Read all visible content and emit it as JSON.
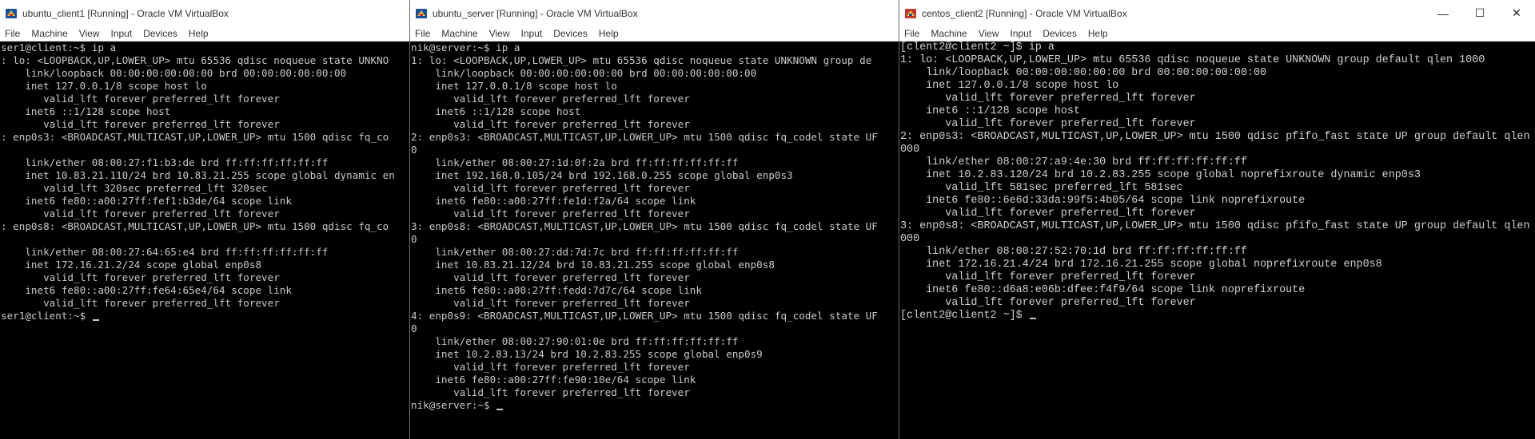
{
  "windows": [
    {
      "title": "ubuntu_client1 [Running] - Oracle VM VirtualBox",
      "menu": [
        "File",
        "Machine",
        "View",
        "Input",
        "Devices",
        "Help"
      ],
      "lines": [
        "ser1@client:~$ ip a",
        ": lo: <LOOPBACK,UP,LOWER_UP> mtu 65536 qdisc noqueue state UNKNO",
        "    link/loopback 00:00:00:00:00:00 brd 00:00:00:00:00:00",
        "    inet 127.0.0.1/8 scope host lo",
        "       valid_lft forever preferred_lft forever",
        "    inet6 ::1/128 scope host",
        "       valid_lft forever preferred_lft forever",
        ": enp0s3: <BROADCAST,MULTICAST,UP,LOWER_UP> mtu 1500 qdisc fq_co",
        "",
        "    link/ether 08:00:27:f1:b3:de brd ff:ff:ff:ff:ff:ff",
        "    inet 10.83.21.110/24 brd 10.83.21.255 scope global dynamic en",
        "       valid_lft 320sec preferred_lft 320sec",
        "    inet6 fe80::a00:27ff:fef1:b3de/64 scope link",
        "       valid_lft forever preferred_lft forever",
        ": enp0s8: <BROADCAST,MULTICAST,UP,LOWER_UP> mtu 1500 qdisc fq_co",
        "",
        "    link/ether 08:00:27:64:65:e4 brd ff:ff:ff:ff:ff:ff",
        "    inet 172.16.21.2/24 scope global enp0s8",
        "       valid_lft forever preferred_lft forever",
        "    inet6 fe80::a00:27ff:fe64:65e4/64 scope link",
        "       valid_lft forever preferred_lft forever",
        "ser1@client:~$ "
      ]
    },
    {
      "title": "ubuntu_server [Running] - Oracle VM VirtualBox",
      "menu": [
        "File",
        "Machine",
        "View",
        "Input",
        "Devices",
        "Help"
      ],
      "lines": [
        "nik@server:~$ ip a",
        "1: lo: <LOOPBACK,UP,LOWER_UP> mtu 65536 qdisc noqueue state UNKNOWN group de",
        "    link/loopback 00:00:00:00:00:00 brd 00:00:00:00:00:00",
        "    inet 127.0.0.1/8 scope host lo",
        "       valid_lft forever preferred_lft forever",
        "    inet6 ::1/128 scope host",
        "       valid_lft forever preferred_lft forever",
        "2: enp0s3: <BROADCAST,MULTICAST,UP,LOWER_UP> mtu 1500 qdisc fq_codel state UF",
        "0",
        "    link/ether 08:00:27:1d:0f:2a brd ff:ff:ff:ff:ff:ff",
        "    inet 192.168.0.105/24 brd 192.168.0.255 scope global enp0s3",
        "       valid_lft forever preferred_lft forever",
        "    inet6 fe80::a00:27ff:fe1d:f2a/64 scope link",
        "       valid_lft forever preferred_lft forever",
        "3: enp0s8: <BROADCAST,MULTICAST,UP,LOWER_UP> mtu 1500 qdisc fq_codel state UF",
        "0",
        "    link/ether 08:00:27:dd:7d:7c brd ff:ff:ff:ff:ff:ff",
        "    inet 10.83.21.12/24 brd 10.83.21.255 scope global enp0s8",
        "       valid_lft forever preferred_lft forever",
        "    inet6 fe80::a00:27ff:fedd:7d7c/64 scope link",
        "       valid_lft forever preferred_lft forever",
        "4: enp0s9: <BROADCAST,MULTICAST,UP,LOWER_UP> mtu 1500 qdisc fq_codel state UF",
        "0",
        "    link/ether 08:00:27:90:01:0e brd ff:ff:ff:ff:ff:ff",
        "    inet 10.2.83.13/24 brd 10.2.83.255 scope global enp0s9",
        "       valid_lft forever preferred_lft forever",
        "    inet6 fe80::a00:27ff:fe90:10e/64 scope link",
        "       valid_lft forever preferred_lft forever",
        "nik@server:~$ "
      ]
    },
    {
      "title": "centos_client2 [Running] - Oracle VM VirtualBox",
      "menu": [
        "File",
        "Machine",
        "View",
        "Input",
        "Devices",
        "Help"
      ],
      "controls": [
        "—",
        "☐",
        "✕"
      ],
      "lines": [
        "[clent2@client2 ~]$ ip a",
        "1: lo: <LOOPBACK,UP,LOWER_UP> mtu 65536 qdisc noqueue state UNKNOWN group default qlen 1000",
        "    link/loopback 00:00:00:00:00:00 brd 00:00:00:00:00:00",
        "    inet 127.0.0.1/8 scope host lo",
        "       valid_lft forever preferred_lft forever",
        "    inet6 ::1/128 scope host",
        "       valid_lft forever preferred_lft forever",
        "2: enp0s3: <BROADCAST,MULTICAST,UP,LOWER_UP> mtu 1500 qdisc pfifo_fast state UP group default qlen 1",
        "000",
        "    link/ether 08:00:27:a9:4e:30 brd ff:ff:ff:ff:ff:ff",
        "    inet 10.2.83.120/24 brd 10.2.83.255 scope global noprefixroute dynamic enp0s3",
        "       valid_lft 581sec preferred_lft 581sec",
        "    inet6 fe80::6e6d:33da:99f5:4b05/64 scope link noprefixroute",
        "       valid_lft forever preferred_lft forever",
        "3: enp0s8: <BROADCAST,MULTICAST,UP,LOWER_UP> mtu 1500 qdisc pfifo_fast state UP group default qlen 1",
        "000",
        "    link/ether 08:00:27:52:70:1d brd ff:ff:ff:ff:ff:ff",
        "    inet 172.16.21.4/24 brd 172.16.21.255 scope global noprefixroute enp0s8",
        "       valid_lft forever preferred_lft forever",
        "    inet6 fe80::d6a8:e06b:dfee:f4f9/64 scope link noprefixroute",
        "       valid_lft forever preferred_lft forever",
        "[clent2@client2 ~]$ "
      ]
    }
  ],
  "colors": {
    "terminal_bg": "#000000",
    "terminal_fg": "#c8c8c8",
    "titlebar_bg": "#ffffff",
    "logo_blue": "#1a4f9c",
    "logo_red": "#c0392b"
  }
}
